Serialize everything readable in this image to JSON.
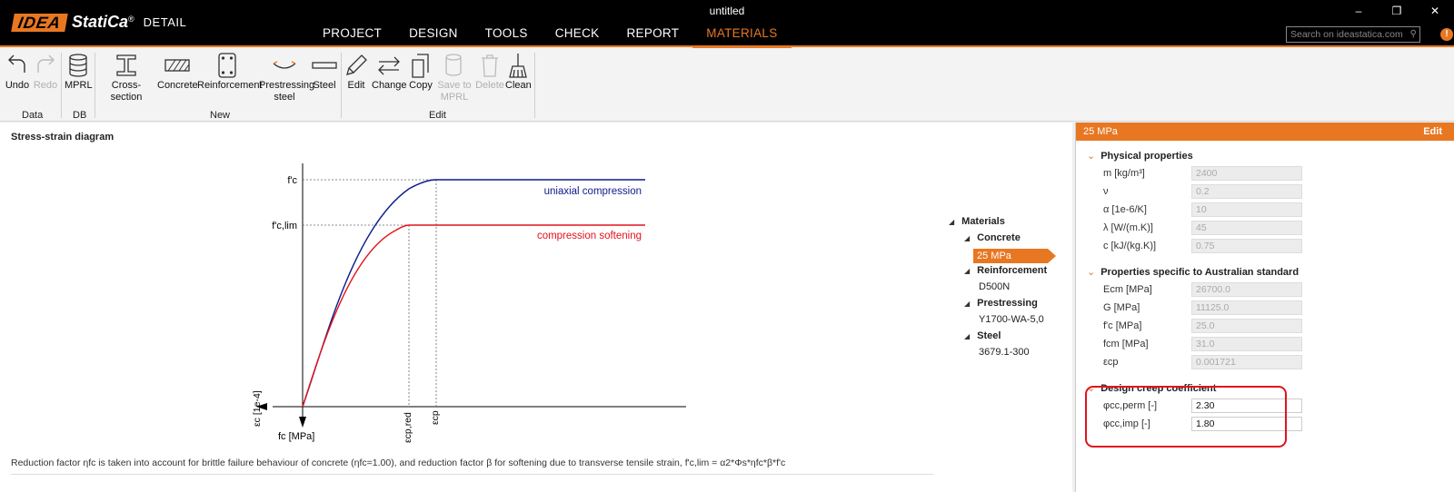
{
  "app": {
    "brand_idea": "IDEA",
    "brand_statica": "StatiCa",
    "brand_reg": "®",
    "brand_product": "DETAIL",
    "window_title": "untitled"
  },
  "window_controls": {
    "minimize": "–",
    "restore": "❐",
    "close": "✕"
  },
  "tabs": [
    "PROJECT",
    "DESIGN",
    "TOOLS",
    "CHECK",
    "REPORT",
    "MATERIALS"
  ],
  "active_tab": "MATERIALS",
  "search": {
    "placeholder": "Search on ideastatica.com"
  },
  "ribbon": {
    "buttons": [
      {
        "label": "Undo",
        "icon": "undo-icon",
        "enabled": true
      },
      {
        "label": "Redo",
        "icon": "redo-icon",
        "enabled": false
      },
      {
        "label": "MPRL",
        "icon": "database-icon",
        "enabled": true
      },
      {
        "label": "Cross-section",
        "icon": "i-beam-icon",
        "enabled": true
      },
      {
        "label": "Concrete",
        "icon": "concrete-icon",
        "enabled": true
      },
      {
        "label": "Reinforcement",
        "icon": "reinforcement-icon",
        "enabled": true
      },
      {
        "label": "Prestressing steel",
        "icon": "prestressing-icon",
        "enabled": true
      },
      {
        "label": "Steel",
        "icon": "steel-icon",
        "enabled": true
      },
      {
        "label": "Edit",
        "icon": "pencil-icon",
        "enabled": true
      },
      {
        "label": "Change",
        "icon": "change-icon",
        "enabled": true
      },
      {
        "label": "Copy",
        "icon": "copy-icon",
        "enabled": true
      },
      {
        "label": "Save to MPRL",
        "icon": "save-db-icon",
        "enabled": false
      },
      {
        "label": "Delete",
        "icon": "trash-icon",
        "enabled": false
      },
      {
        "label": "Clean",
        "icon": "broom-icon",
        "enabled": true
      }
    ],
    "groups": [
      "Data",
      "DB",
      "New",
      "Edit"
    ]
  },
  "diagram": {
    "title": "Stress-strain diagram",
    "labels": {
      "fc": "f'c",
      "fc_lim": "f'c,lim",
      "uniaxial": "uniaxial compression",
      "softening": "compression softening",
      "x_axis": "εc [1e-4]",
      "y_axis": "fc [MPa]",
      "ecp_red": "εcp,red",
      "ecp": "εcp"
    },
    "colors": {
      "uniaxial": "#0d1a8a",
      "softening": "#e2131a"
    },
    "footnote": "Reduction factor ηfc is taken into account for brittle failure behaviour of concrete (ηfc=1.00), and reduction factor β for softening due to transverse tensile strain, f'c,lim = α2*Φs*ηfc*β*f'c"
  },
  "tree": {
    "root": "Materials",
    "concrete_label": "Concrete",
    "concrete_item": "25 MPa",
    "reinforcement_label": "Reinforcement",
    "reinforcement_item": "D500N",
    "prestressing_label": "Prestressing",
    "prestressing_item": "Y1700-WA-5,0",
    "steel_label": "Steel",
    "steel_item": "3679.1-300"
  },
  "panel": {
    "title": "25 MPa",
    "edit": "Edit",
    "physical": {
      "title": "Physical properties",
      "rows": [
        {
          "label": "m [kg/m³]",
          "value": "2400"
        },
        {
          "label": "ν",
          "value": "0.2"
        },
        {
          "label": "α [1e-6/K]",
          "value": "10"
        },
        {
          "label": "λ [W/(m.K)]",
          "value": "45"
        },
        {
          "label": "c [kJ/(kg.K)]",
          "value": "0.75"
        }
      ]
    },
    "specific": {
      "title": "Properties specific to Australian standard",
      "rows": [
        {
          "label": "Ecm [MPa]",
          "value": "26700.0"
        },
        {
          "label": "G [MPa]",
          "value": "11125.0"
        },
        {
          "label": "f'c [MPa]",
          "value": "25.0"
        },
        {
          "label": "fcm [MPa]",
          "value": "31.0"
        },
        {
          "label": "εcp",
          "value": "0.001721"
        }
      ]
    },
    "creep": {
      "title": "Design creep coefficient",
      "rows": [
        {
          "label": "φcc,perm [-]",
          "value": "2.30"
        },
        {
          "label": "φcc,imp [-]",
          "value": "1.80"
        }
      ]
    }
  }
}
